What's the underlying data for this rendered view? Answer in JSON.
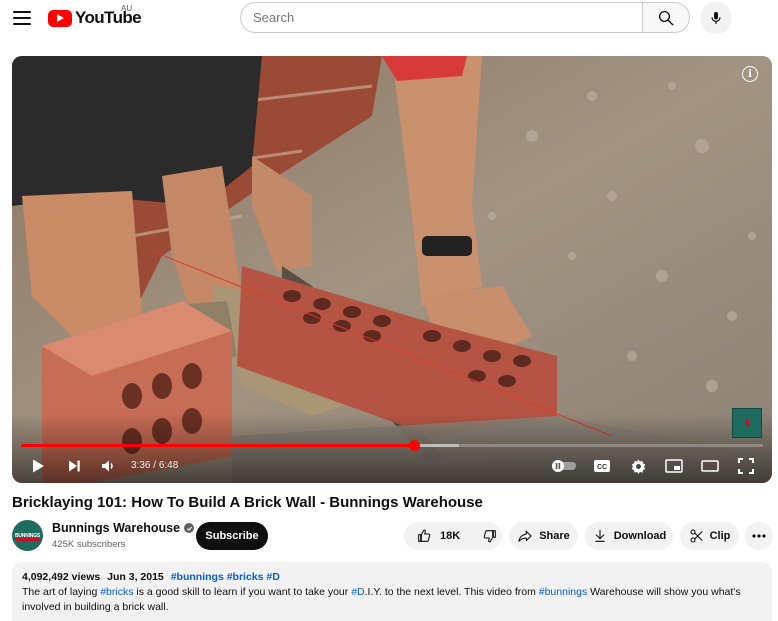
{
  "header": {
    "logo_text": "YouTube",
    "region": "AU",
    "search_placeholder": "Search"
  },
  "player": {
    "current_time": "3:36",
    "duration": "6:48",
    "progress_fraction": 0.53,
    "buffered_fraction": 0.59,
    "time_separator": "/"
  },
  "video": {
    "title": "Bricklaying 101: How To Build A Brick Wall - Bunnings Warehouse"
  },
  "channel": {
    "name": "Bunnings Warehouse",
    "subscribers": "425K subscribers",
    "avatar_text": "BUNNINGS WAREHOUSE"
  },
  "actions": {
    "subscribe": "Subscribe",
    "likes": "18K",
    "share": "Share",
    "download": "Download",
    "clip": "Clip"
  },
  "description": {
    "views": "4,092,492 views",
    "date": "Jun 3, 2015",
    "meta_tags": [
      "#bunnings",
      "#bricks",
      "#D"
    ],
    "line1_a": "The art of laying ",
    "line1_tag1": "#bricks",
    "line1_b": "  is a good skill to learn if you want to take your ",
    "line1_tag2": "#D",
    "line1_c": ".I.Y. to the next level. This video from ",
    "line1_tag3": "#bunnings",
    "line1_d": "  Warehouse will show you what's",
    "line2": "involved in building a brick wall."
  },
  "colors": {
    "brand_red": "#ff0000",
    "link_blue": "#065fd4",
    "bunnings_green": "#1e6b5f"
  }
}
